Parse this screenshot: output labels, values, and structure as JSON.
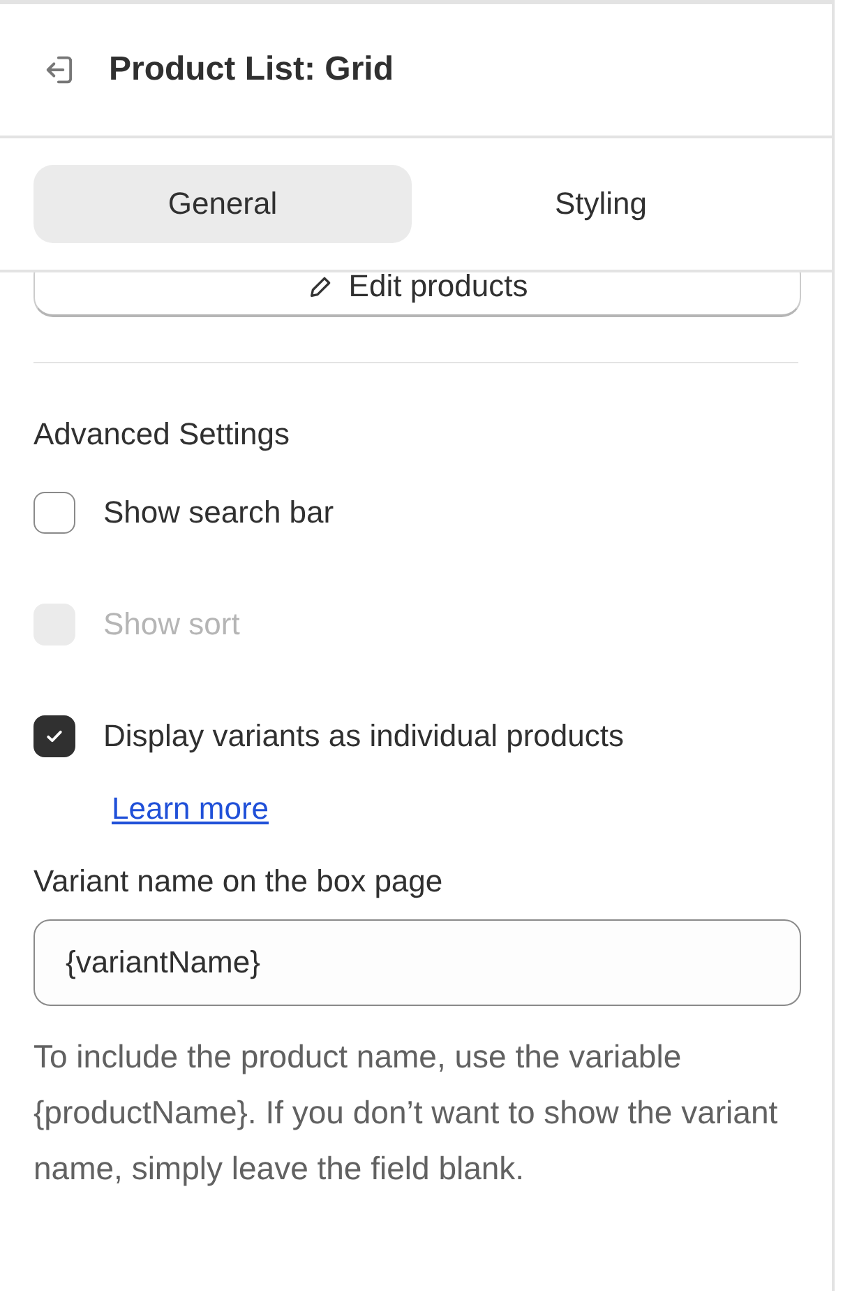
{
  "header": {
    "title": "Product List: Grid"
  },
  "tabs": [
    {
      "label": "General",
      "selected": true
    },
    {
      "label": "Styling",
      "selected": false
    }
  ],
  "edit_button": {
    "label": "Edit products"
  },
  "section": {
    "title": "Advanced Settings"
  },
  "options": [
    {
      "label": "Show search bar",
      "checked": false,
      "disabled": false
    },
    {
      "label": "Show sort",
      "checked": false,
      "disabled": true
    },
    {
      "label": "Display variants as individual products",
      "checked": true,
      "disabled": false,
      "link": "Learn more"
    }
  ],
  "variant_field": {
    "label": "Variant name on the box page",
    "value": "{variantName}",
    "help": "To include the product name, use the variable {productName}. If you don’t want to show the variant name, simply leave the field blank."
  }
}
